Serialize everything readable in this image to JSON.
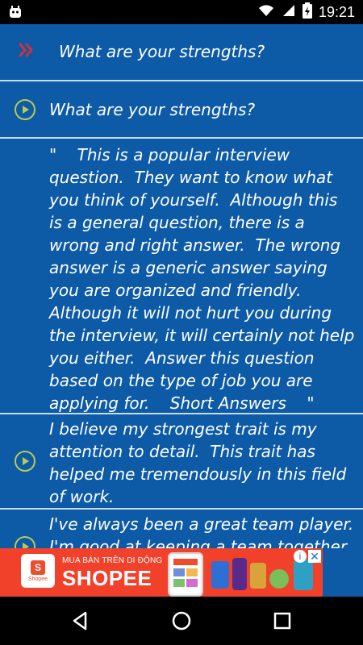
{
  "status_bar": {
    "time": "19:21",
    "icons": [
      "app-notification-icon",
      "wifi-icon",
      "signal-icon",
      "battery-icon"
    ]
  },
  "content": {
    "header": {
      "icon": "double-chevron-right-icon",
      "title": "What are your strengths?"
    },
    "rows": [
      {
        "icon": "play-circle-icon",
        "text": "What are your strengths?"
      },
      {
        "icon": "",
        "text": "\"    This is a popular interview question.  They want to know what you think of yourself.  Although this is a general question, there is a wrong and right answer.  The wrong answer is a generic answer saying you are organized and friendly.  Although it will not hurt you during the interview, it will certainly not help you either.  Answer this question based on the type of job you are applying for.    Short Answers    \""
      },
      {
        "icon": "play-circle-icon",
        "text": "I believe my strongest trait is my attention to detail.  This trait has helped me tremendously in this field of work."
      },
      {
        "icon": "play-circle-icon",
        "text": "I've always been a great team player. I'm good at keeping a team together"
      }
    ]
  },
  "ad": {
    "brand": "Shopee",
    "badge_letter": "S",
    "tagline": "MUA BÁN TRÊN DI ĐỘNG",
    "headline": "SHOPEE",
    "info_icon": "ad-info-icon",
    "close_icon": "ad-close-icon",
    "info_glyph": "i",
    "close_glyph": "✕"
  },
  "navigation": {
    "back": "back-triangle-icon",
    "home": "home-circle-icon",
    "recents": "recents-square-icon"
  },
  "colors": {
    "background": "#0d5aa7",
    "divider": "#dfe9f7",
    "accent_icon": "#b7c957",
    "chevron": "#d0313c",
    "ad_bg": "#f2412a"
  }
}
